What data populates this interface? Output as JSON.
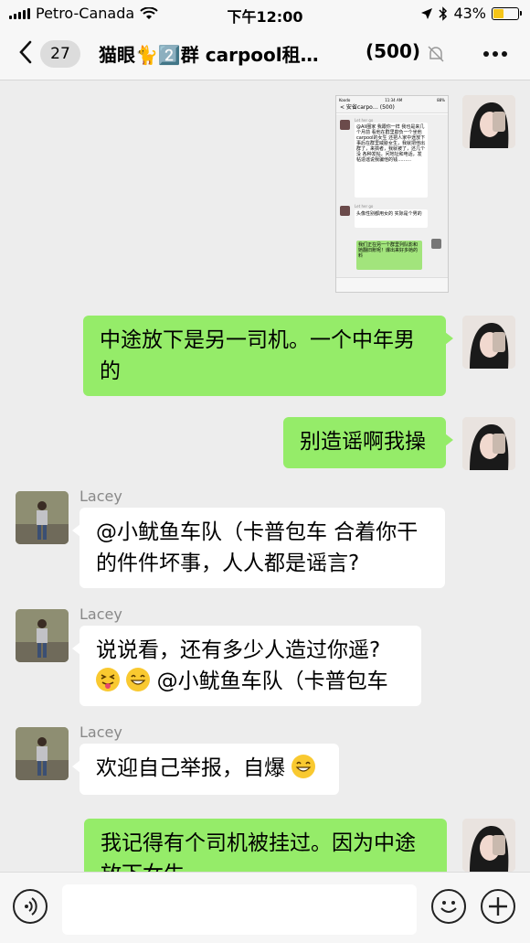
{
  "status_bar": {
    "carrier": "Petro-Canada",
    "time": "下午12:00",
    "battery": "43%",
    "battery_level": 0.43
  },
  "nav": {
    "back_icon": "chevron-left-icon",
    "unread_count": "27",
    "title": "猫眼🐈2️⃣群 carpool租…",
    "member_count": "(500)",
    "more_icon": "more-dots-icon"
  },
  "thumbnail": {
    "status_left": "Koodo",
    "status_time": "11:34 AM",
    "status_right": "88%",
    "nav_title": "< 安省carpo…  (500)",
    "sender1": "Let her go",
    "msg1": "@Ali圈家 我跟你一样 我也是来几个月前 看他在群里欺负一个坐他carpool的女生 还把人家中途放下 事后在群里威胁女生，我就把他出群了，来搞者，我就被了，还几个没 各种发帖，问地址和电话，发帖造谣说我骗他的钱………",
    "sender2": "Let her go",
    "msg2": "头像性别都用女的 实际是个男的",
    "msg3": "我们正在另一个群里列队影和她翻旧账呢！爆出来好多她的料"
  },
  "messages": [
    {
      "side": "self",
      "text": "中途放下是另一司机。一个中年男的"
    },
    {
      "side": "self",
      "text": "别造谣啊我操"
    },
    {
      "side": "other",
      "sender": "Lacey",
      "text": "@小鱿鱼车队（卡普包车 合着你干的件件坏事，人人都是谣言?"
    },
    {
      "side": "other",
      "sender": "Lacey",
      "text_line1": "说说看，还有多少人造过你遥?",
      "text_line2": "@小鱿鱼车队（卡普包车"
    },
    {
      "side": "other",
      "sender": "Lacey",
      "text": "欢迎自己举报，自爆"
    },
    {
      "side": "self",
      "text": "我记得有个司机被挂过。因为中途放下女生"
    }
  ],
  "input_bar": {
    "voice_icon": "voice-icon",
    "emoji_icon": "emoji-icon",
    "plus_icon": "plus-icon"
  },
  "colors": {
    "self_bubble": "#95ec69",
    "other_bubble": "#ffffff",
    "background": "#ededed"
  }
}
